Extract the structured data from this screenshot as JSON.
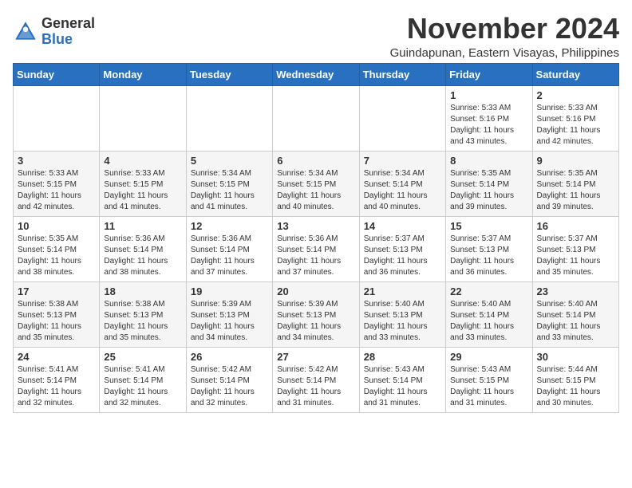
{
  "logo": {
    "general": "General",
    "blue": "Blue"
  },
  "title": "November 2024",
  "subtitle": "Guindapunan, Eastern Visayas, Philippines",
  "weekdays": [
    "Sunday",
    "Monday",
    "Tuesday",
    "Wednesday",
    "Thursday",
    "Friday",
    "Saturday"
  ],
  "weeks": [
    [
      {
        "day": "",
        "info": ""
      },
      {
        "day": "",
        "info": ""
      },
      {
        "day": "",
        "info": ""
      },
      {
        "day": "",
        "info": ""
      },
      {
        "day": "",
        "info": ""
      },
      {
        "day": "1",
        "info": "Sunrise: 5:33 AM\nSunset: 5:16 PM\nDaylight: 11 hours\nand 43 minutes."
      },
      {
        "day": "2",
        "info": "Sunrise: 5:33 AM\nSunset: 5:16 PM\nDaylight: 11 hours\nand 42 minutes."
      }
    ],
    [
      {
        "day": "3",
        "info": "Sunrise: 5:33 AM\nSunset: 5:15 PM\nDaylight: 11 hours\nand 42 minutes."
      },
      {
        "day": "4",
        "info": "Sunrise: 5:33 AM\nSunset: 5:15 PM\nDaylight: 11 hours\nand 41 minutes."
      },
      {
        "day": "5",
        "info": "Sunrise: 5:34 AM\nSunset: 5:15 PM\nDaylight: 11 hours\nand 41 minutes."
      },
      {
        "day": "6",
        "info": "Sunrise: 5:34 AM\nSunset: 5:15 PM\nDaylight: 11 hours\nand 40 minutes."
      },
      {
        "day": "7",
        "info": "Sunrise: 5:34 AM\nSunset: 5:14 PM\nDaylight: 11 hours\nand 40 minutes."
      },
      {
        "day": "8",
        "info": "Sunrise: 5:35 AM\nSunset: 5:14 PM\nDaylight: 11 hours\nand 39 minutes."
      },
      {
        "day": "9",
        "info": "Sunrise: 5:35 AM\nSunset: 5:14 PM\nDaylight: 11 hours\nand 39 minutes."
      }
    ],
    [
      {
        "day": "10",
        "info": "Sunrise: 5:35 AM\nSunset: 5:14 PM\nDaylight: 11 hours\nand 38 minutes."
      },
      {
        "day": "11",
        "info": "Sunrise: 5:36 AM\nSunset: 5:14 PM\nDaylight: 11 hours\nand 38 minutes."
      },
      {
        "day": "12",
        "info": "Sunrise: 5:36 AM\nSunset: 5:14 PM\nDaylight: 11 hours\nand 37 minutes."
      },
      {
        "day": "13",
        "info": "Sunrise: 5:36 AM\nSunset: 5:14 PM\nDaylight: 11 hours\nand 37 minutes."
      },
      {
        "day": "14",
        "info": "Sunrise: 5:37 AM\nSunset: 5:13 PM\nDaylight: 11 hours\nand 36 minutes."
      },
      {
        "day": "15",
        "info": "Sunrise: 5:37 AM\nSunset: 5:13 PM\nDaylight: 11 hours\nand 36 minutes."
      },
      {
        "day": "16",
        "info": "Sunrise: 5:37 AM\nSunset: 5:13 PM\nDaylight: 11 hours\nand 35 minutes."
      }
    ],
    [
      {
        "day": "17",
        "info": "Sunrise: 5:38 AM\nSunset: 5:13 PM\nDaylight: 11 hours\nand 35 minutes."
      },
      {
        "day": "18",
        "info": "Sunrise: 5:38 AM\nSunset: 5:13 PM\nDaylight: 11 hours\nand 35 minutes."
      },
      {
        "day": "19",
        "info": "Sunrise: 5:39 AM\nSunset: 5:13 PM\nDaylight: 11 hours\nand 34 minutes."
      },
      {
        "day": "20",
        "info": "Sunrise: 5:39 AM\nSunset: 5:13 PM\nDaylight: 11 hours\nand 34 minutes."
      },
      {
        "day": "21",
        "info": "Sunrise: 5:40 AM\nSunset: 5:13 PM\nDaylight: 11 hours\nand 33 minutes."
      },
      {
        "day": "22",
        "info": "Sunrise: 5:40 AM\nSunset: 5:14 PM\nDaylight: 11 hours\nand 33 minutes."
      },
      {
        "day": "23",
        "info": "Sunrise: 5:40 AM\nSunset: 5:14 PM\nDaylight: 11 hours\nand 33 minutes."
      }
    ],
    [
      {
        "day": "24",
        "info": "Sunrise: 5:41 AM\nSunset: 5:14 PM\nDaylight: 11 hours\nand 32 minutes."
      },
      {
        "day": "25",
        "info": "Sunrise: 5:41 AM\nSunset: 5:14 PM\nDaylight: 11 hours\nand 32 minutes."
      },
      {
        "day": "26",
        "info": "Sunrise: 5:42 AM\nSunset: 5:14 PM\nDaylight: 11 hours\nand 32 minutes."
      },
      {
        "day": "27",
        "info": "Sunrise: 5:42 AM\nSunset: 5:14 PM\nDaylight: 11 hours\nand 31 minutes."
      },
      {
        "day": "28",
        "info": "Sunrise: 5:43 AM\nSunset: 5:14 PM\nDaylight: 11 hours\nand 31 minutes."
      },
      {
        "day": "29",
        "info": "Sunrise: 5:43 AM\nSunset: 5:15 PM\nDaylight: 11 hours\nand 31 minutes."
      },
      {
        "day": "30",
        "info": "Sunrise: 5:44 AM\nSunset: 5:15 PM\nDaylight: 11 hours\nand 30 minutes."
      }
    ]
  ]
}
